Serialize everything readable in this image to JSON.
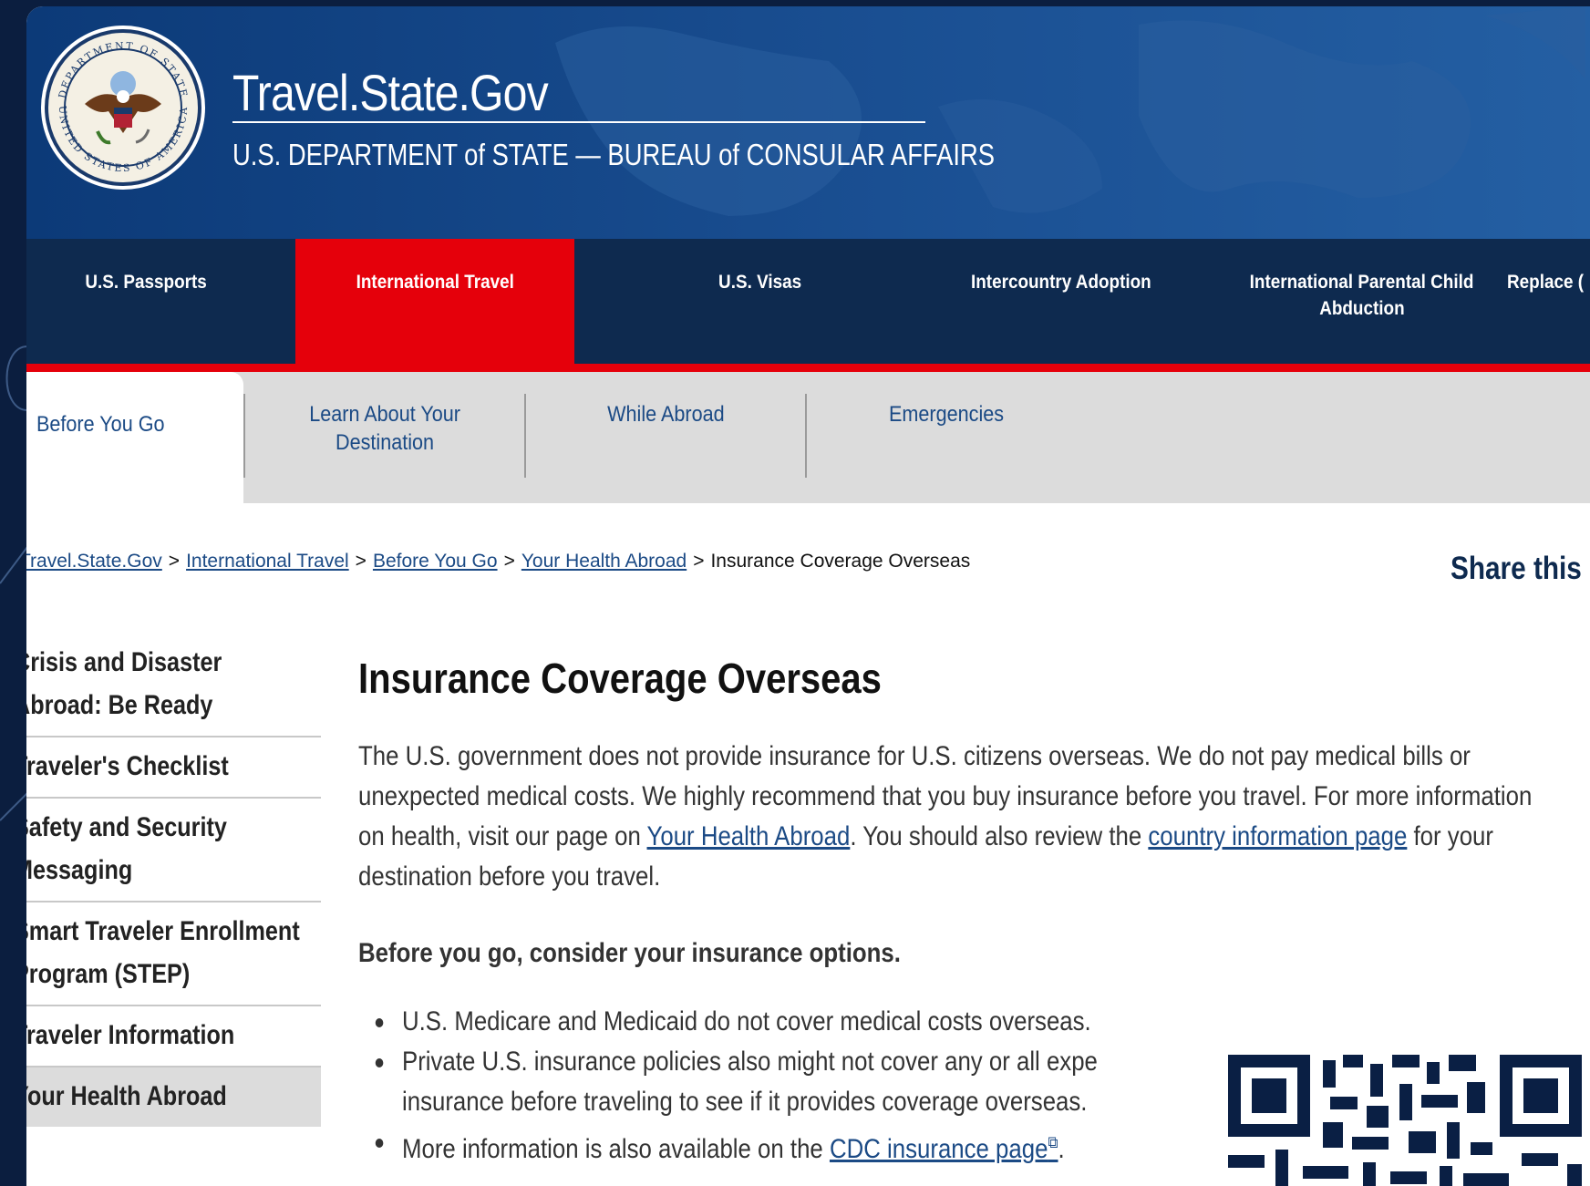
{
  "header": {
    "seal_alt": "Department of State seal",
    "seal_text_top": "DEPARTMENT OF STATE",
    "seal_text_bottom": "UNITED STATES OF AMERICA",
    "site_title": "Travel.State.Gov",
    "subtitle": "U.S. DEPARTMENT of STATE — BUREAU of CONSULAR AFFAIRS"
  },
  "primary_nav": [
    {
      "label": "U.S. Passports",
      "active": false
    },
    {
      "label": "International Travel",
      "active": true
    },
    {
      "label": "U.S. Visas",
      "active": false
    },
    {
      "label": "Intercountry Adoption",
      "active": false
    },
    {
      "label_line1": "International Parental Child",
      "label_line2": "Abduction",
      "active": false
    },
    {
      "label": "Replace (",
      "active": false
    }
  ],
  "secondary_nav": [
    {
      "label": "Before You Go",
      "active": true
    },
    {
      "label_line1": "Learn About Your",
      "label_line2": "Destination",
      "active": false
    },
    {
      "label": "While Abroad",
      "active": false
    },
    {
      "label": "Emergencies",
      "active": false
    }
  ],
  "breadcrumb": {
    "items": [
      "Travel.State.Gov",
      "International Travel",
      "Before You Go",
      "Your Health Abroad"
    ],
    "current": "Insurance Coverage Overseas",
    "separator": ">"
  },
  "share_label": "Share this",
  "left_nav": [
    {
      "line1": "Crisis and Disaster",
      "line2": "Abroad: Be Ready"
    },
    {
      "line1": "Traveler's Checklist"
    },
    {
      "line1": "Safety and Security",
      "line2": "Messaging"
    },
    {
      "line1": "Smart Traveler Enrollment",
      "line2": "Program (STEP)"
    },
    {
      "line1": "Traveler Information"
    },
    {
      "line1": "Your Health Abroad",
      "current": true
    }
  ],
  "main": {
    "title": "Insurance Coverage Overseas",
    "intro_part1": "The U.S. government does not provide insurance for U.S. citizens overseas. We do not pay medical bills or unexpected medical costs. We highly recommend that you buy insurance before you travel. For more information on health, visit our page on ",
    "intro_link1": "Your Health Abroad",
    "intro_part2": ". You should also review the ",
    "intro_link2": "country information page",
    "intro_part3": " for your destination before you travel.",
    "subhead": "Before you go, consider your insurance options.",
    "bullet1": "U.S. Medicare and Medicaid do not cover medical costs overseas.",
    "bullet2": "Private U.S. insurance policies also might not cover any or all expe",
    "bullet2_line2": "insurance before traveling to see if it provides coverage overseas.",
    "bullet3_part1": "More information is also available on the ",
    "bullet3_link": "CDC insurance page",
    "bullet3_part2": "."
  },
  "icons": {
    "external_link": "external-link-icon",
    "qr_code": "qr-code"
  },
  "colors": {
    "header_blue": "#1a4f92",
    "nav_navy": "#0e2a4f",
    "active_red": "#e5000b",
    "link_blue": "#1b4a85",
    "subnav_gray": "#dcdcdc"
  }
}
